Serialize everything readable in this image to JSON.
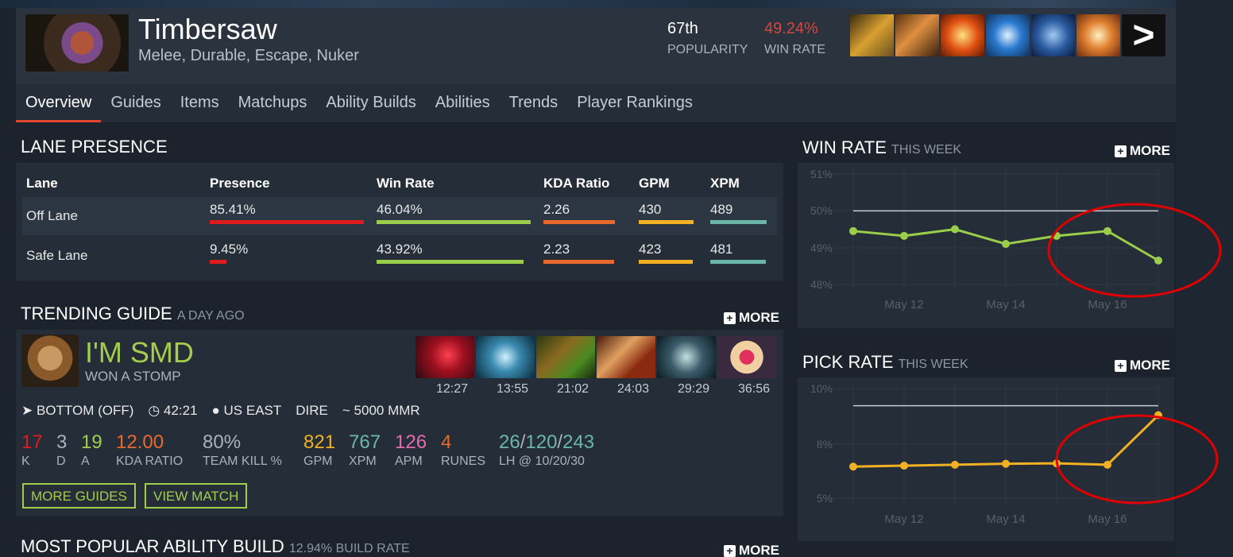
{
  "hero": {
    "name": "Timbersaw",
    "roles": "Melee, Durable, Escape, Nuker",
    "popularity_value": "67th",
    "popularity_label": "POPULARITY",
    "winrate_value": "49.24%",
    "winrate_label": "WIN RATE",
    "more_glyph": ">"
  },
  "tabs": [
    "Overview",
    "Guides",
    "Items",
    "Matchups",
    "Ability Builds",
    "Abilities",
    "Trends",
    "Player Rankings"
  ],
  "lane": {
    "title": "LANE PRESENCE",
    "headers": [
      "Lane",
      "Presence",
      "Win Rate",
      "KDA Ratio",
      "GPM",
      "XPM"
    ],
    "rows": [
      {
        "lane": "Off Lane",
        "presence": "85.41%",
        "presence_pct": 85.41,
        "winrate": "46.04%",
        "kda": "2.26",
        "gpm": "430",
        "xpm": "489"
      },
      {
        "lane": "Safe Lane",
        "presence": "9.45%",
        "presence_pct": 9.45,
        "winrate": "43.92%",
        "kda": "2.23",
        "gpm": "423",
        "xpm": "481"
      }
    ]
  },
  "trending": {
    "title": "TRENDING GUIDE",
    "subtitle": "A DAY AGO",
    "more": "MORE",
    "player": "I'M SMD",
    "result": "WON A STOMP",
    "item_times": [
      "12:27",
      "13:55",
      "21:02",
      "24:03",
      "29:29",
      "36:56"
    ],
    "meta": {
      "lane": "BOTTOM (OFF)",
      "duration": "42:21",
      "region": "US EAST",
      "side": "DIRE",
      "mmr": "~ 5000 MMR"
    },
    "stats": {
      "k": "17",
      "d": "3",
      "a": "19",
      "kda": "12.00",
      "teamkill": "80%",
      "gpm": "821",
      "xpm": "767",
      "apm": "126",
      "runes": "4",
      "lh1": "26",
      "lh2": "120",
      "lh3": "243",
      "k_label": "K",
      "d_label": "D",
      "a_label": "A",
      "kda_label": "KDA RATIO",
      "teamkill_label": "TEAM KILL %",
      "gpm_label": "GPM",
      "xpm_label": "XPM",
      "apm_label": "APM",
      "runes_label": "RUNES",
      "lh_label": "LH @ 10/20/30",
      "slash": "/"
    },
    "btn_more": "MORE GUIDES",
    "btn_view": "VIEW MATCH"
  },
  "popular_build": {
    "title": "MOST POPULAR ABILITY BUILD",
    "subtitle": "12.94% BUILD RATE",
    "more": "MORE"
  },
  "winrate_chart_header": {
    "title": "WIN RATE",
    "subtitle": "THIS WEEK",
    "more": "MORE"
  },
  "pickrate_chart_header": {
    "title": "PICK RATE",
    "subtitle": "THIS WEEK",
    "more": "MORE"
  },
  "chart_data": [
    {
      "type": "line",
      "title": "WIN RATE",
      "yticks": [
        "51%",
        "50%",
        "49%",
        "48%"
      ],
      "ylim": [
        48,
        51
      ],
      "xticks": [
        "May 12",
        "May 14",
        "May 16"
      ],
      "x": [
        "May 11",
        "May 12",
        "May 13",
        "May 14",
        "May 15",
        "May 16",
        "May 17"
      ],
      "values": [
        49.45,
        49.32,
        49.5,
        49.1,
        49.32,
        49.45,
        48.65
      ],
      "reference": 50,
      "color": "#9acd4a"
    },
    {
      "type": "line",
      "title": "PICK RATE",
      "yticks": [
        "10%",
        "8%",
        "5%"
      ],
      "ylim": [
        4.2,
        10
      ],
      "xticks": [
        "May 12",
        "May 14",
        "May 16"
      ],
      "x": [
        "May 11",
        "May 12",
        "May 13",
        "May 14",
        "May 15",
        "May 16",
        "May 17"
      ],
      "values": [
        5.9,
        5.95,
        6.0,
        6.05,
        6.07,
        6.0,
        8.6
      ],
      "reference": 9.1,
      "color": "#f2b024"
    }
  ],
  "colors": {
    "accent": "#e4452f",
    "green": "#a3cc4c",
    "red": "#e01b1b",
    "orange": "#e8692a",
    "yellow": "#f2b024",
    "teal": "#6bb7a7",
    "pink": "#e86ab0",
    "annotation": "#e00000"
  }
}
